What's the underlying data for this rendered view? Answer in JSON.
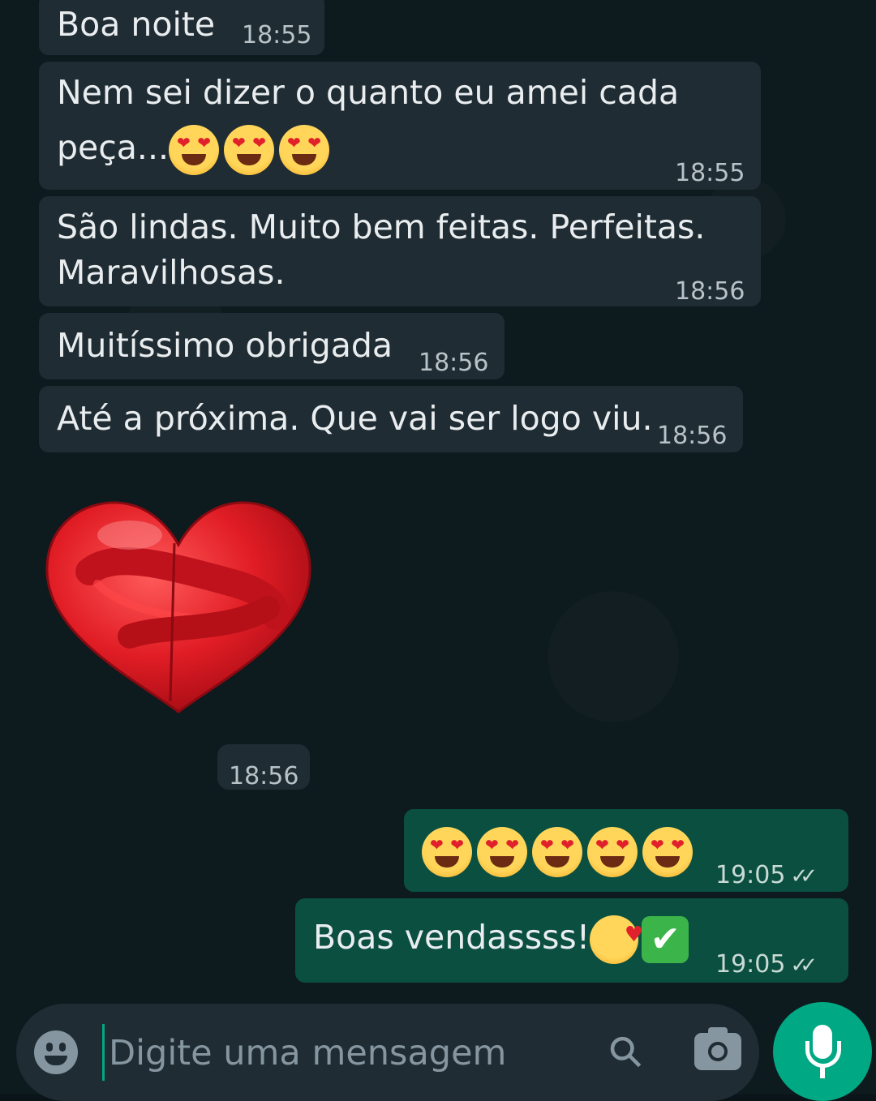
{
  "messages": [
    {
      "text": "Boa noite",
      "time": "18:55"
    },
    {
      "text_line1": "Nem sei dizer o quanto eu amei cada",
      "text_line2": "peça...",
      "time": "18:55",
      "emoji": "heart-eyes-emoji x3"
    },
    {
      "text_line1": "São lindas. Muito bem feitas. Perfeitas.",
      "text_line2": "Maravilhosas.",
      "time": "18:56"
    },
    {
      "text": "Muitíssimo obrigada",
      "time": "18:56"
    },
    {
      "text": "Até a próxima. Que vai ser logo viu.",
      "time": "18:56"
    },
    {
      "sticker": "heart-hug-sticker",
      "time": "18:56"
    }
  ],
  "outgoing": [
    {
      "emoji": "heart-eyes-emoji x5",
      "time": "19:05",
      "status": "read"
    },
    {
      "text": "Boas vendassss!",
      "emoji": "smiling-face-with-hearts, check-mark-button",
      "time": "19:05",
      "status": "read"
    }
  ],
  "input": {
    "placeholder": "Digite uma mensagem"
  },
  "colors": {
    "incoming": "#1f2c33",
    "outgoing": "#0b4f41",
    "accent": "#00a884"
  }
}
